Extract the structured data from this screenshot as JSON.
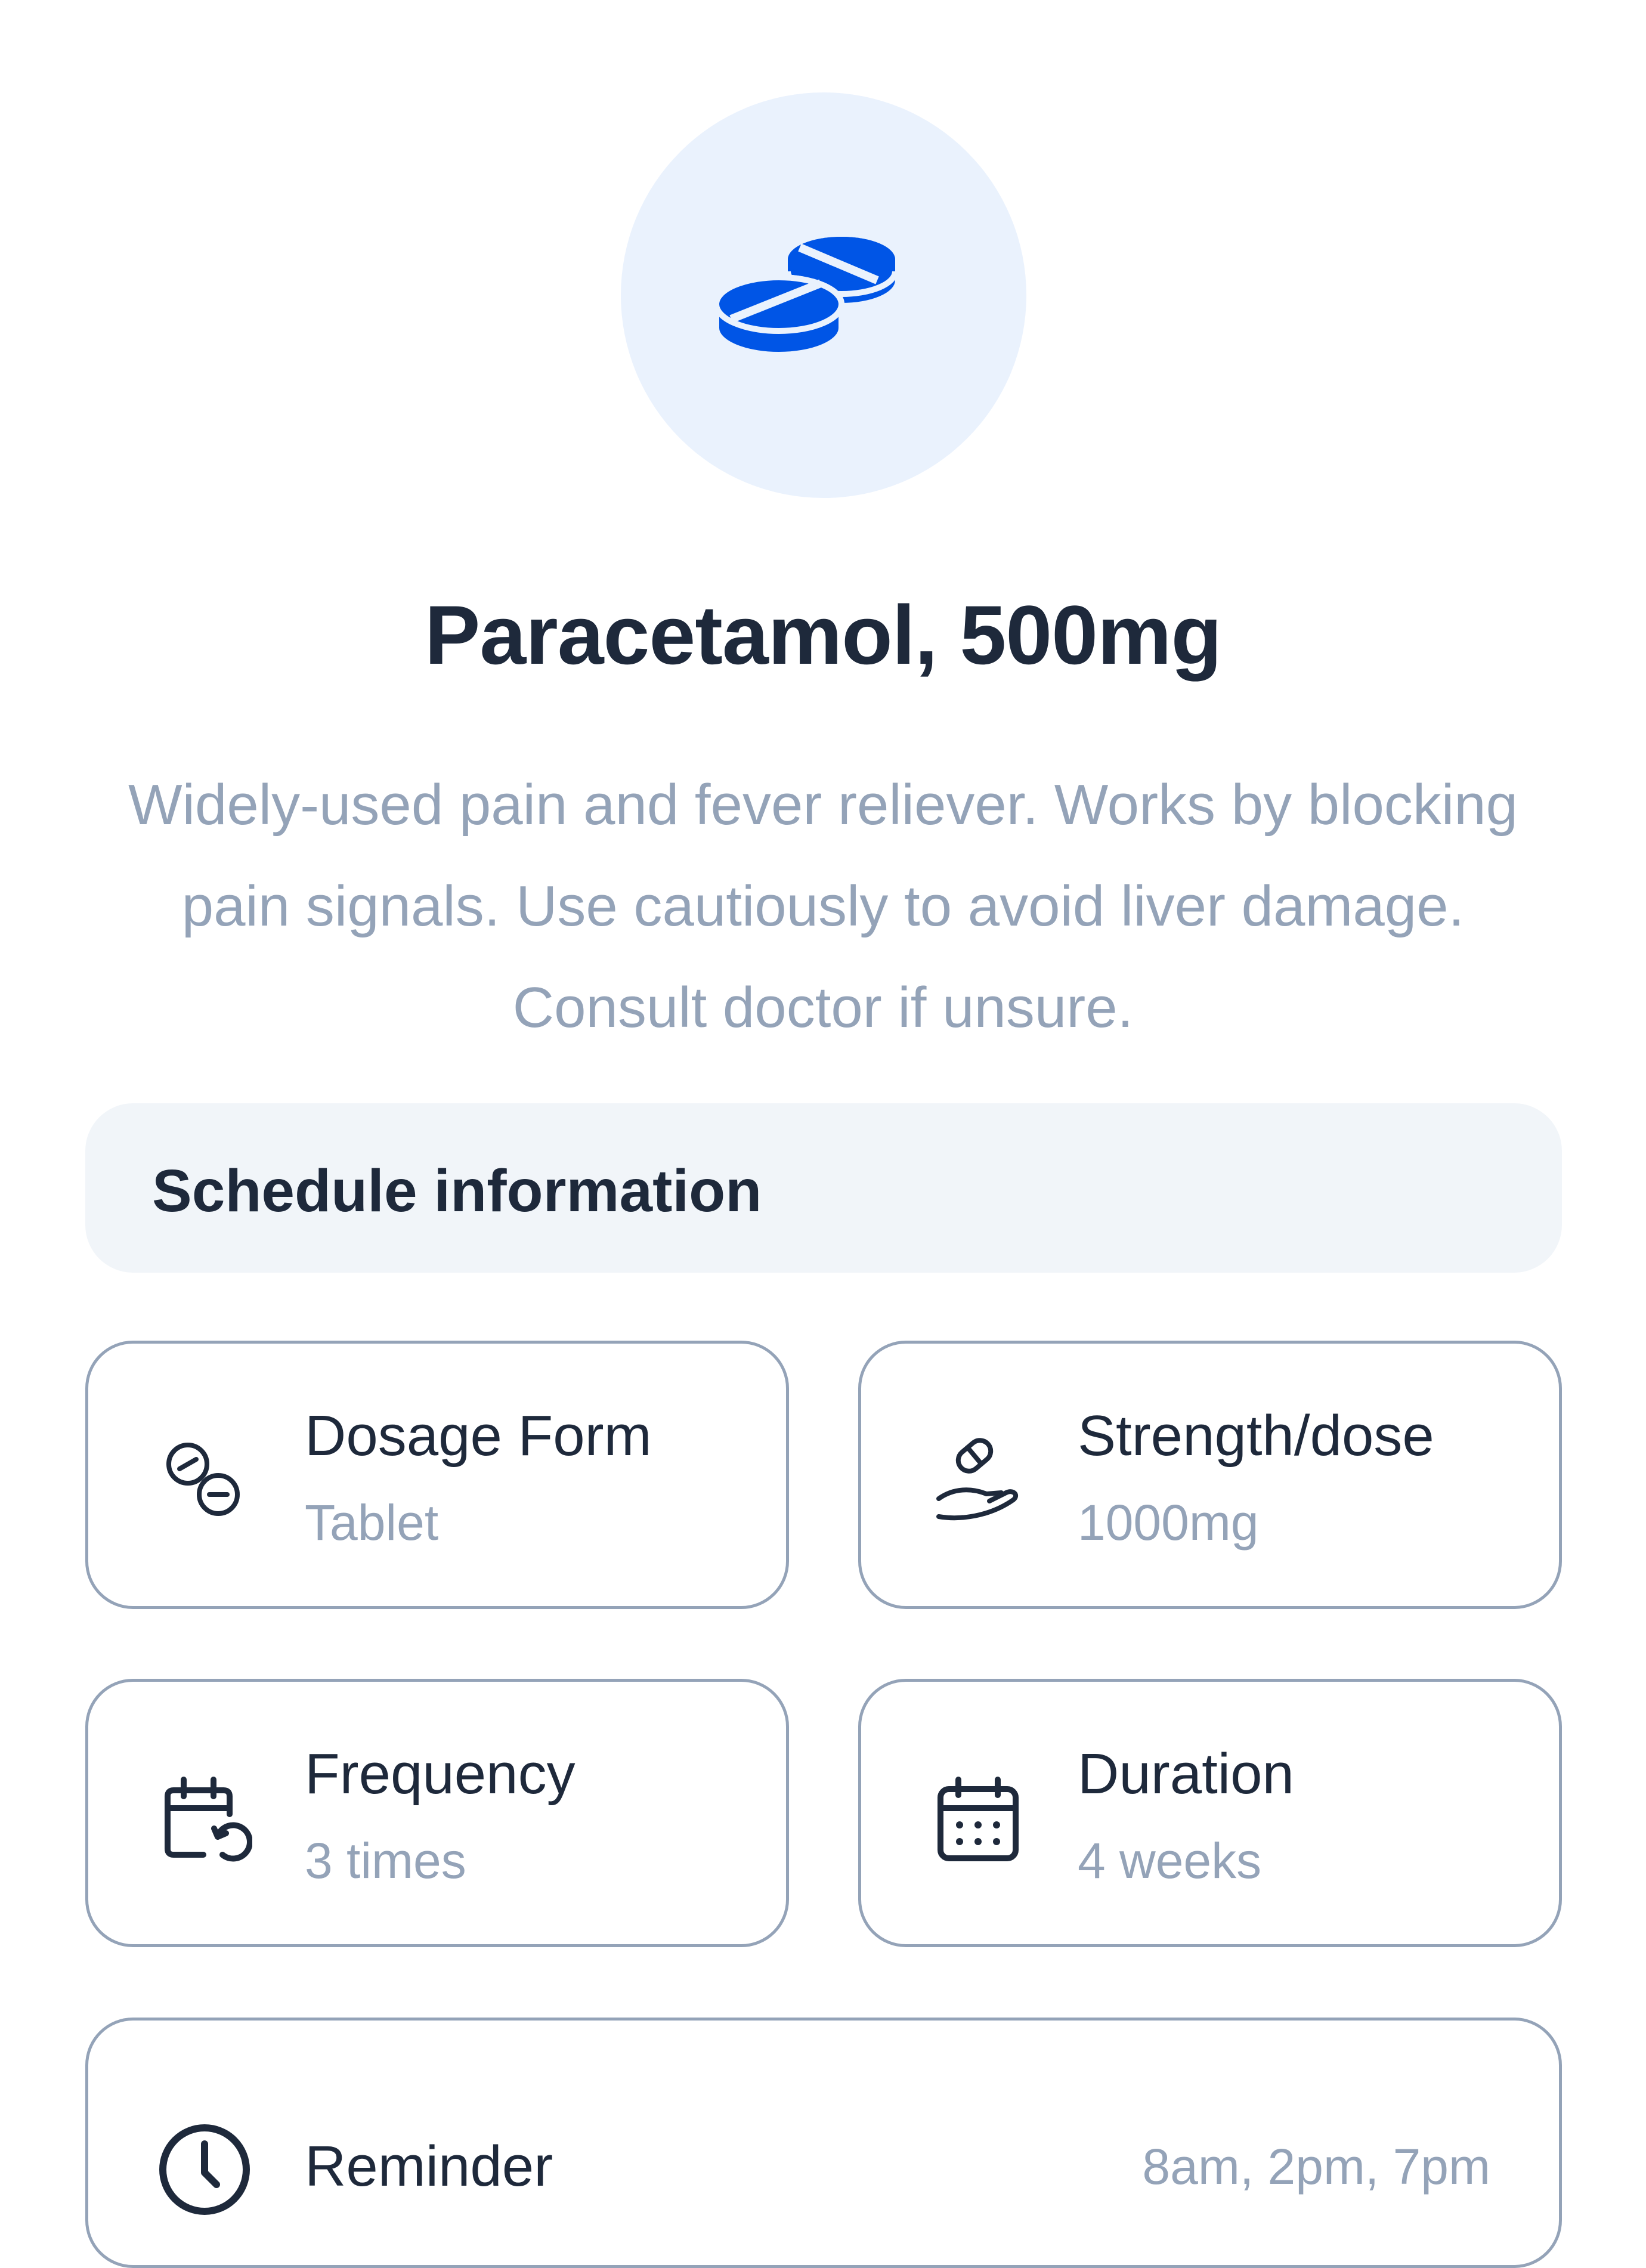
{
  "medication": {
    "icon": "pills-icon",
    "title": "Paracetamol, 500mg",
    "description": "Widely-used pain and fever reliever. Works by blocking pain signals. Use cautiously to avoid liver damage. Consult doctor if unsure."
  },
  "schedule": {
    "header": "Schedule information",
    "cards": [
      {
        "icon": "tablets-icon",
        "label": "Dosage Form",
        "value": "Tablet"
      },
      {
        "icon": "hand-pill-icon",
        "label": "Strength/dose",
        "value": "1000mg"
      },
      {
        "icon": "calendar-repeat-icon",
        "label": "Frequency",
        "value": "3 times"
      },
      {
        "icon": "calendar-icon",
        "label": "Duration",
        "value": "4 weeks"
      }
    ],
    "reminder": {
      "icon": "clock-icon",
      "label": "Reminder",
      "value": "8am, 2pm, 7pm"
    }
  },
  "colors": {
    "accent": "#0055e6",
    "hero_bg": "#eaf2fd",
    "text_primary": "#1e293b",
    "text_secondary": "#94a3b8",
    "header_bg": "#f1f5f9",
    "card_border": "#94a3b8"
  }
}
